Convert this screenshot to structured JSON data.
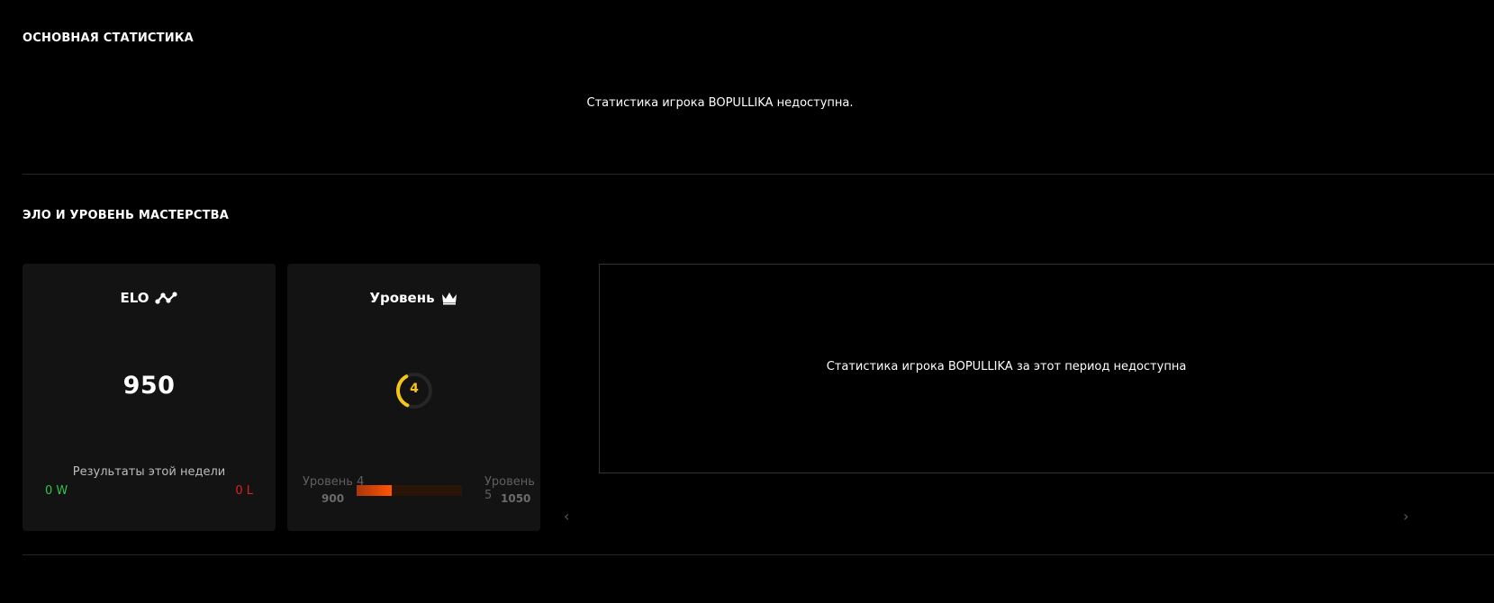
{
  "sections": {
    "main_stats": {
      "title": "ОСНОВНАЯ СТАТИСТИКА",
      "message": "Статистика игрока BOPULLIKA недоступна."
    },
    "elo_level": {
      "title": "ЭЛО И УРОВЕНЬ МАСТЕРСТВА"
    }
  },
  "elo_card": {
    "title": "ELO",
    "icon": "elo-graph-icon",
    "value": "950",
    "week_label": "Результаты этой недели",
    "wins": "0 W",
    "losses": "0 L"
  },
  "level_card": {
    "title": "Уровень",
    "icon": "crown-icon",
    "level": "4",
    "gauge_progress": 0.35,
    "from_label": "Уровень 4",
    "from_elo": "900",
    "to_label": "Уровень 5",
    "to_elo": "1050",
    "progress_fraction": 0.333
  },
  "period": {
    "message": "Статистика игрока BOPULLIKA за этот период недоступна"
  },
  "nav": {
    "prev_icon": "chevron-left-icon",
    "next_icon": "chevron-right-icon",
    "prev_glyph": "‹",
    "next_glyph": "›"
  },
  "colors": {
    "background": "#000000",
    "card": "#131313",
    "win": "#32c24d",
    "loss": "#e0201b",
    "level": "#f5c518",
    "progress": "#ff5500"
  }
}
